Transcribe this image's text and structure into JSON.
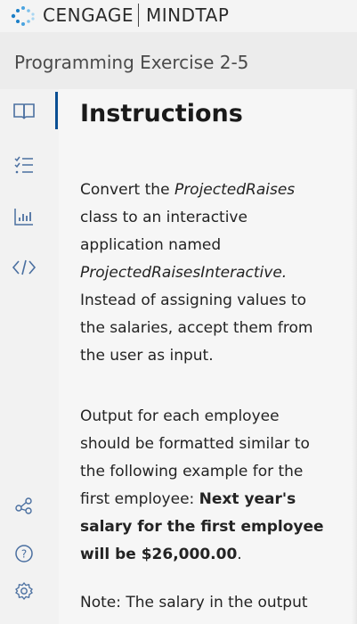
{
  "header": {
    "brand": "CENGAGE",
    "product": "MINDTAP"
  },
  "exercise": {
    "title": "Programming Exercise 2-5"
  },
  "sidebar": {
    "items": [
      {
        "icon": "book-icon",
        "label": "Instructions"
      },
      {
        "icon": "checklist-icon",
        "label": "Tasks"
      },
      {
        "icon": "bar-chart-icon",
        "label": "Results"
      },
      {
        "icon": "code-icon",
        "label": "Code"
      },
      {
        "icon": "share-icon",
        "label": "Share"
      },
      {
        "icon": "help-icon",
        "label": "Help"
      },
      {
        "icon": "settings-icon",
        "label": "Settings"
      }
    ]
  },
  "main": {
    "heading": "Instructions",
    "p1": {
      "a": "Convert the ",
      "b": "ProjectedRaises",
      "c": " class to an interactive application named ",
      "d": "ProjectedRaisesInteractive.",
      "e": " Instead of assigning values to the salaries, accept them from the user as input."
    },
    "p2": {
      "a": "Output for each employee should be formatted similar to the following example for the first employee: ",
      "b": "Next year's salary for the first employee will be $26,000.00",
      "c": "."
    },
    "p3": {
      "a": "Note: The salary in the output"
    }
  }
}
